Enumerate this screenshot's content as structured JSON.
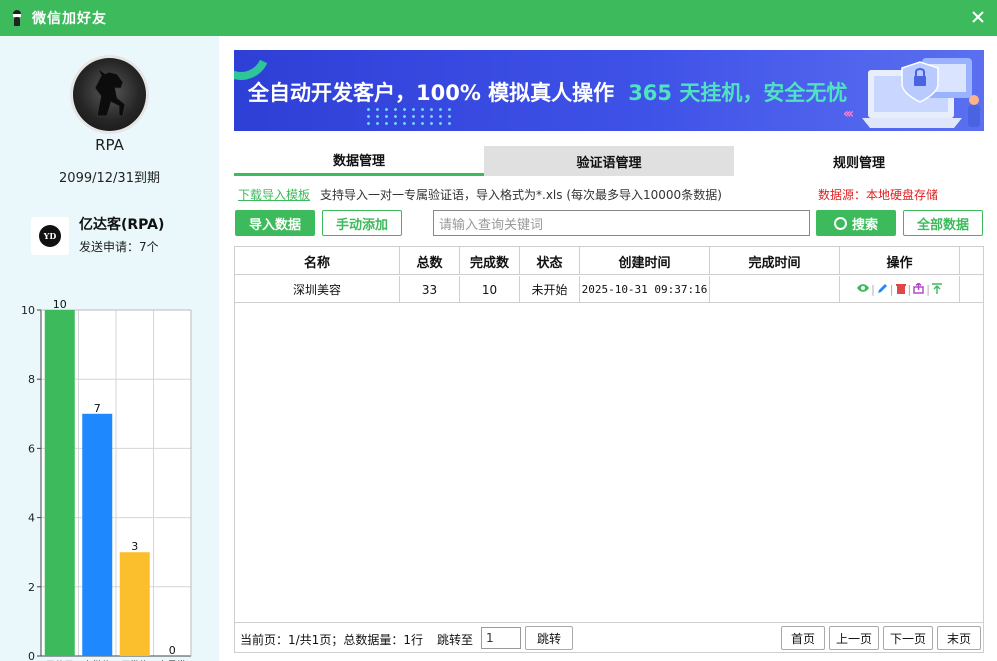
{
  "window": {
    "title": "微信加好友"
  },
  "profile": {
    "name": "RPA",
    "expire": "2099/12/31到期"
  },
  "account": {
    "logo_text": "YD",
    "name": "亿达客(RPA)",
    "sub": "发送申请：7个"
  },
  "colors": {
    "accent": "#3dba5c",
    "used": "#3dba5c",
    "has_wechat": "#1e88ff",
    "no_wechat": "#fbbf2e",
    "abnormal": "#e04848",
    "danger": "#e02020"
  },
  "chart_data": {
    "type": "bar",
    "categories": [
      "已使用",
      "有微信",
      "无微信",
      "有异常"
    ],
    "values": [
      10,
      7,
      3,
      0
    ],
    "ylim": [
      0,
      10
    ],
    "yticks": [
      0,
      2,
      4,
      6,
      8,
      10
    ],
    "grid": true
  },
  "banner": {
    "text_main": "全自动开发客户，100% 模拟真人操作",
    "text_highlight": "365 天挂机，安全无忧"
  },
  "tabs": [
    {
      "label": "数据管理",
      "active": true
    },
    {
      "label": "验证语管理",
      "active": false
    },
    {
      "label": "规则管理",
      "active": false
    }
  ],
  "info": {
    "download": "下载导入模板",
    "desc": "支持导入一对一专属验证语，导入格式为*.xls  (每次最多导入10000条数据)",
    "source": "数据源：本地硬盘存储"
  },
  "toolbar": {
    "import": "导入数据",
    "manual": "手动添加",
    "search_placeholder": "请输入查询关键词",
    "search": "搜索",
    "all": "全部数据"
  },
  "table": {
    "headers": [
      "名称",
      "总数",
      "完成数",
      "状态",
      "创建时间",
      "完成时间",
      "操作"
    ],
    "rows": [
      {
        "name": "深圳美容",
        "total": "33",
        "done": "10",
        "status": "未开始",
        "created": "2025-10-31 09:37:16",
        "finished": ""
      }
    ],
    "op_icons": [
      "eye-icon",
      "edit-icon",
      "delete-icon",
      "export-icon",
      "top-icon"
    ]
  },
  "pager": {
    "info": "当前页：1/共1页；总数据量：1行",
    "jump_label": "跳转至",
    "jump_value": "1",
    "jump_btn": "跳转",
    "first": "首页",
    "prev": "上一页",
    "next": "下一页",
    "last": "末页"
  }
}
